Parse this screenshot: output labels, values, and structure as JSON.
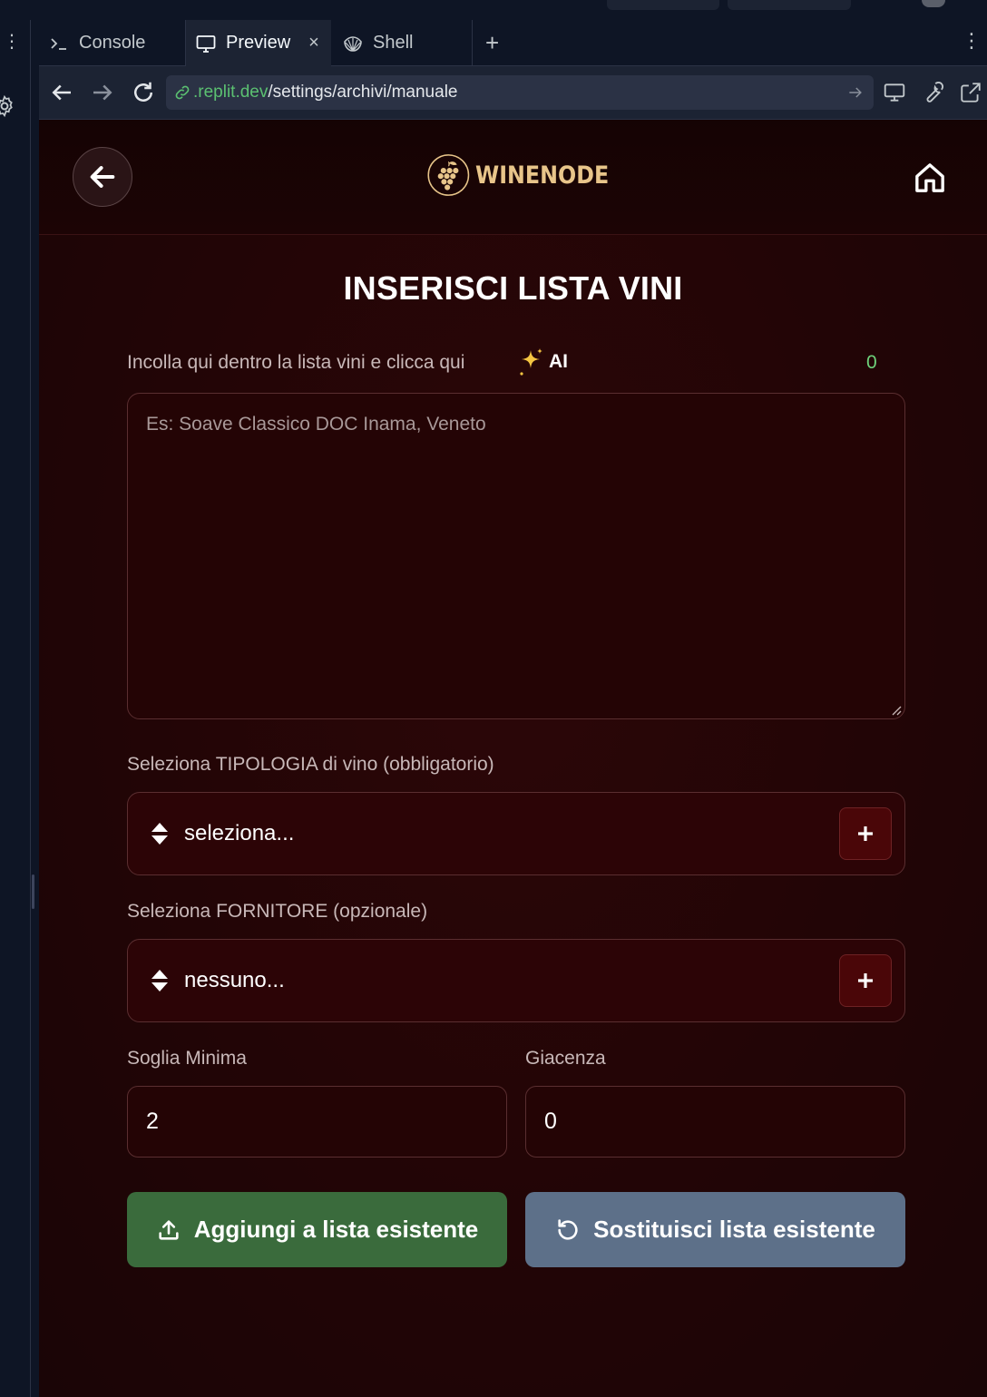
{
  "ide": {
    "tabs": [
      {
        "label": "Console",
        "icon": "terminal-icon"
      },
      {
        "label": "Preview",
        "icon": "monitor-icon",
        "active": true
      },
      {
        "label": "Shell",
        "icon": "shell-icon"
      }
    ],
    "url": {
      "host": ".replit.dev",
      "path": "/settings/archivi/manuale"
    }
  },
  "app": {
    "brand": "WINENODE",
    "page_title": "INSERISCI LISTA VINI",
    "paste": {
      "label": "Incolla qui dentro la lista vini e clicca qui",
      "ai_label": "AI",
      "counter": "0",
      "placeholder": "Es: Soave Classico DOC Inama, Veneto"
    },
    "tipologia": {
      "label": "Seleziona TIPOLOGIA di vino (obbligatorio)",
      "value": "seleziona..."
    },
    "fornitore": {
      "label": "Seleziona FORNITORE (opzionale)",
      "value": "nessuno..."
    },
    "soglia": {
      "label": "Soglia Minima",
      "value": "2"
    },
    "giacenza": {
      "label": "Giacenza",
      "value": "0"
    },
    "buttons": {
      "add": "Aggiungi a lista esistente",
      "replace": "Sostituisci lista esistente"
    }
  },
  "colors": {
    "accent_gold": "#e8c58a",
    "add_button": "#3a6b3c",
    "replace_button": "#5d7089",
    "counter_green": "#6ed27a"
  }
}
